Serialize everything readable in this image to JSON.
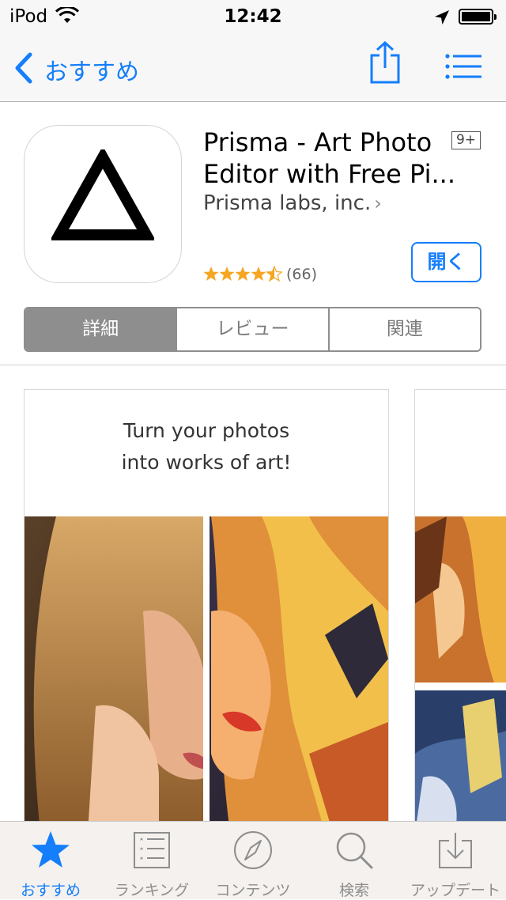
{
  "status_bar": {
    "carrier": "iPod",
    "time": "12:42"
  },
  "nav": {
    "back_label": "おすすめ",
    "share_icon": "share-icon",
    "list_icon": "list-icon"
  },
  "app": {
    "title_line1": "Prisma - Art Photo",
    "title_line2": "Editor with Free Pi...",
    "developer": "Prisma labs, inc.",
    "age_rating": "9+",
    "rating_stars": 4.5,
    "rating_count": "(66)",
    "open_label": "開く"
  },
  "segments": [
    {
      "label": "詳細",
      "active": true
    },
    {
      "label": "レビュー",
      "active": false
    },
    {
      "label": "関連",
      "active": false
    }
  ],
  "screenshot": {
    "caption_line1": "Turn your photos",
    "caption_line2": "into works of art!"
  },
  "tabs": [
    {
      "label": "おすすめ",
      "icon": "star-icon",
      "active": true
    },
    {
      "label": "ランキング",
      "icon": "ranking-list-icon",
      "active": false
    },
    {
      "label": "コンテンツ",
      "icon": "compass-icon",
      "active": false
    },
    {
      "label": "検索",
      "icon": "search-icon",
      "active": false
    },
    {
      "label": "アップデート",
      "icon": "download-tray-icon",
      "active": false
    }
  ],
  "colors": {
    "accent": "#147efb",
    "star": "#f5a623",
    "segment_active": "#8e8e8e"
  }
}
